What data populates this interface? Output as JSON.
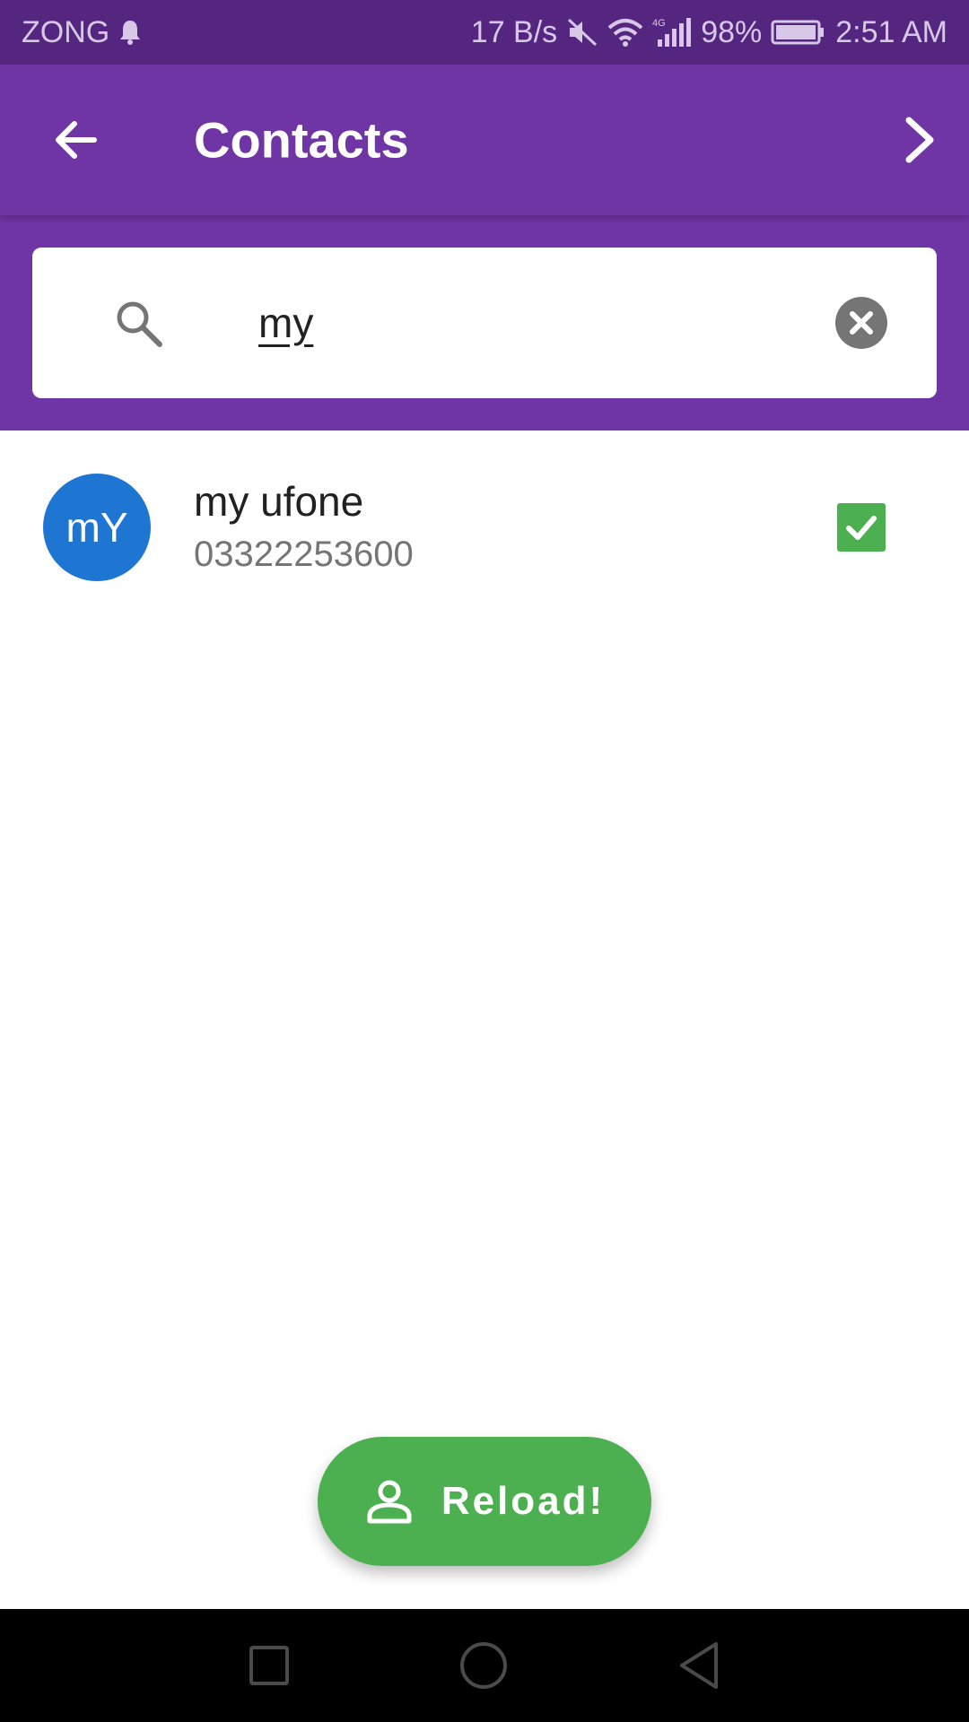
{
  "status_bar": {
    "carrier": "ZONG",
    "speed": "17 B/s",
    "network": "4G",
    "battery": "98%",
    "time": "2:51 AM",
    "icons": [
      "bell-icon",
      "mute-icon",
      "wifi-icon",
      "signal-icon",
      "battery-icon"
    ]
  },
  "app_bar": {
    "title": "Contacts",
    "back_icon": "arrow-left-icon",
    "next_icon": "chevron-right-icon"
  },
  "search": {
    "value": "my",
    "icon": "search-icon",
    "clear_icon": "clear-circle-icon"
  },
  "contacts": [
    {
      "initials": "mY",
      "name": "my ufone",
      "phone": "03322253600",
      "selected": true,
      "avatar_color": "#1f76d2"
    }
  ],
  "fab": {
    "label": "Reload!",
    "icon": "person-icon"
  },
  "colors": {
    "status_bar": "#552680",
    "primary": "#6f35a5",
    "accent_green": "#4caf50",
    "avatar_blue": "#1f76d2"
  },
  "nav_bar": {
    "buttons": [
      "recent-apps-icon",
      "home-icon",
      "back-icon"
    ]
  }
}
